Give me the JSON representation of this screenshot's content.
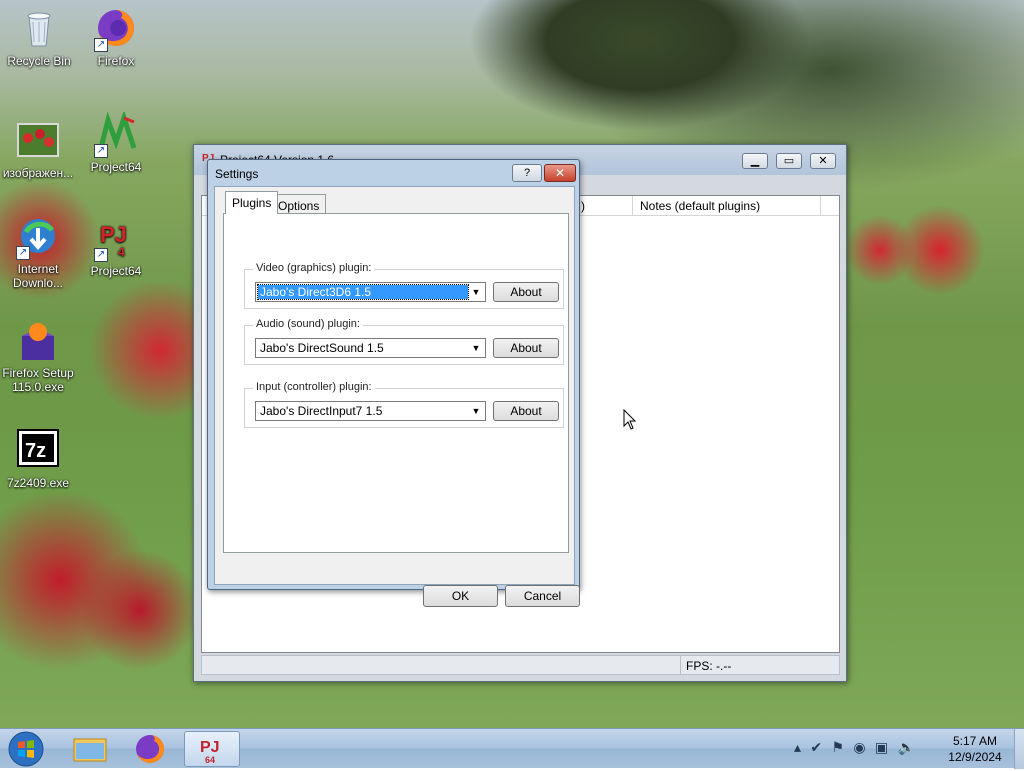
{
  "desktop": {
    "icons": [
      {
        "label": "Recycle Bin",
        "icon": "recycle-bin-icon"
      },
      {
        "label": "Firefox",
        "icon": "firefox-icon"
      },
      {
        "label": "изображен...",
        "icon": "image-file-icon"
      },
      {
        "label": "Project64",
        "icon": "project64-icon"
      },
      {
        "label": "Internet Downlo...",
        "icon": "internet-download-manager-icon"
      },
      {
        "label": "Project64",
        "icon": "project64-icon"
      },
      {
        "label": "Firefox Setup 115.0.exe",
        "icon": "firefox-setup-icon"
      },
      {
        "label": "7z2409.exe",
        "icon": "7zip-icon"
      }
    ]
  },
  "main_window": {
    "title": "Project64 Version 1.6",
    "columns": [
      "",
      ")",
      "Notes (default plugins)"
    ],
    "status": {
      "fps": "FPS: -.--"
    }
  },
  "settings_dialog": {
    "title": "Settings",
    "help_label": "?",
    "close_label": "✕",
    "tabs": [
      {
        "label": "Plugins",
        "active": true
      },
      {
        "label": "Options",
        "active": false
      }
    ],
    "groups": [
      {
        "label": "Video (graphics) plugin:",
        "value": "Jabo's Direct3D6 1.5",
        "selected": true,
        "button": "About"
      },
      {
        "label": "Audio (sound) plugin:",
        "value": "Jabo's DirectSound 1.5",
        "selected": false,
        "button": "About"
      },
      {
        "label": "Input (controller) plugin:",
        "value": "Jabo's DirectInput7 1.5",
        "selected": false,
        "button": "About"
      }
    ],
    "ok_label": "OK",
    "cancel_label": "Cancel"
  },
  "taskbar": {
    "items": [
      "windows-explorer-icon",
      "firefox-icon",
      "project64-icon"
    ],
    "clock": {
      "time": "5:17 AM",
      "date": "12/9/2024"
    },
    "tray": [
      "show-hidden-icons",
      "action-center-icon",
      "flag-icon",
      "network-icon",
      "display-icon",
      "volume-icon"
    ]
  },
  "colors": {
    "selection": "#3399ff",
    "taskbar": "#a9c3df",
    "dialog_frame": "#bcd0e6"
  }
}
